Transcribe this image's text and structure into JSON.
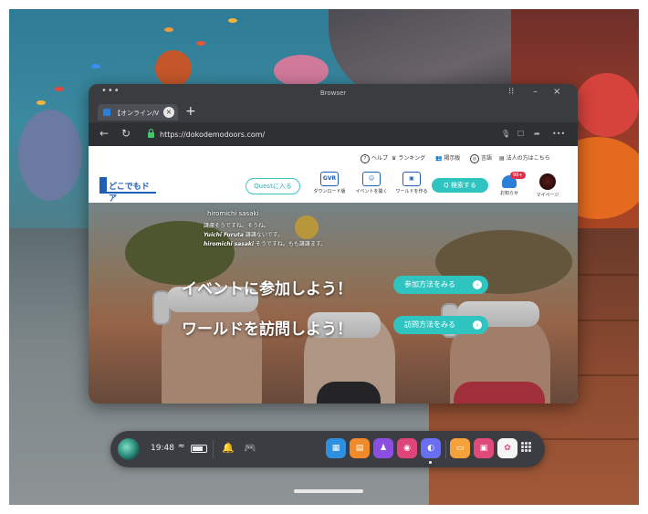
{
  "window": {
    "title": "Browser",
    "menu_dots": "•••",
    "controls": {
      "grip": "⁝⁝",
      "minimize": "–",
      "close": "×"
    }
  },
  "tabs": [
    {
      "label": "【オンライン/V",
      "close": "×"
    }
  ],
  "new_tab": "+",
  "nav": {
    "back": "←",
    "reload": "↻",
    "url": "https://dokodemodoors.com/",
    "right_icons": [
      "mic-icon",
      "bookmark-icon",
      "share-icon",
      "more-icon"
    ],
    "more": "•••"
  },
  "site": {
    "utility_links": [
      {
        "icon": "help-icon",
        "glyph": "?",
        "label": "ヘルプ"
      },
      {
        "icon": "crown-icon",
        "glyph": "♛",
        "label": "ランキング"
      },
      {
        "icon": "users-icon",
        "glyph": "👥",
        "label": "掲示板"
      },
      {
        "icon": "globe-icon",
        "glyph": "◎",
        "label": "言語"
      },
      {
        "icon": "building-icon",
        "glyph": "▤",
        "label": "法人の方はこちら"
      }
    ],
    "logo_text": "どこでもドア",
    "quest_button": "Questに入る",
    "header_items": [
      {
        "icon": "vr-download-icon",
        "glyph": "GVR",
        "label": "ダウンロード版"
      },
      {
        "icon": "event-icon",
        "glyph": "☺",
        "label": "イベントを開く"
      },
      {
        "icon": "world-icon",
        "glyph": "▣",
        "label": "ワールドを作る"
      }
    ],
    "search_button": "Q 検索する",
    "notifications": {
      "badge": "99+",
      "label": "お知らせ"
    },
    "mypage_label": "マイページ",
    "hero": {
      "caption_lines": [
        {
          "name": "",
          "text": "hiromichi sasaki"
        },
        {
          "name": "",
          "text": "謙慮そうですね。そうね。"
        },
        {
          "name": "Yuichi Furuta",
          "text": "謙謙ないです。"
        },
        {
          "name": "hiromichi sasaki",
          "text": "そうですね。もも謙謙ます。"
        }
      ],
      "cta": [
        {
          "heading": "イベントに参加しよう！",
          "button": "参加方法をみる"
        },
        {
          "heading": "ワールドを訪問しよう！",
          "button": "訪問方法をみる"
        }
      ],
      "arrow_glyph": "›"
    }
  },
  "taskbar": {
    "time": "19:48",
    "wifi": "≈",
    "icons": [
      "notification-bell-icon",
      "controller-icon"
    ],
    "apps": [
      {
        "name": "store",
        "color": "#2f8fe0",
        "glyph": "▦"
      },
      {
        "name": "shopping",
        "color": "#f08a2a",
        "glyph": "▤"
      },
      {
        "name": "people",
        "color": "#8a4fe0",
        "glyph": "♟"
      },
      {
        "name": "camera",
        "color": "#e0457a",
        "glyph": "◉"
      },
      {
        "name": "browser",
        "color": "#6a6ff0",
        "glyph": "◐"
      },
      {
        "name": "orange-app",
        "color": "#f5a23a",
        "glyph": "▭"
      },
      {
        "name": "tv",
        "color": "#e04a7a",
        "glyph": "▣"
      },
      {
        "name": "gallery",
        "color": "#f5f5f5",
        "glyph": "✿"
      }
    ]
  }
}
